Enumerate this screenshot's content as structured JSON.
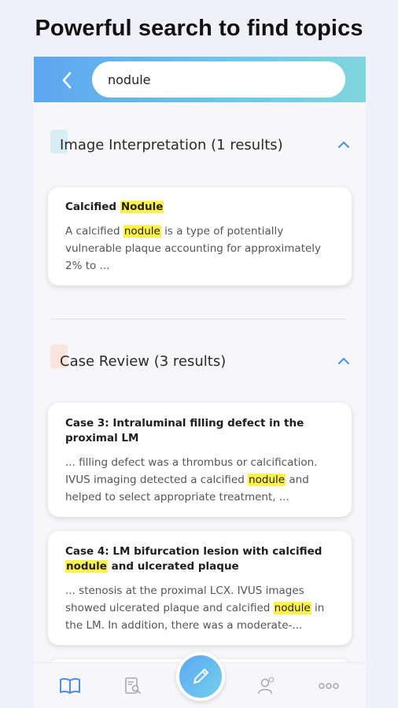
{
  "headline": "Powerful search to find topics",
  "search": {
    "query": "nodule"
  },
  "sections": [
    {
      "title": "Image Interpretation (1 results)",
      "accent_color": "#d6eef4",
      "results": [
        {
          "title_pre": "Calcified ",
          "title_hl": "Nodule",
          "body_pre": "A calcified ",
          "body_hl": "nodule",
          "body_post": " is a type of potentially vulnerable plaque accounting for approximately 2% to ..."
        }
      ]
    },
    {
      "title": "Case Review (3 results)",
      "accent_color": "#fbe4dd",
      "results": [
        {
          "title": "Case 3: Intraluminal filling defect in the proximal LM",
          "body_pre": "... filling defect was a thrombus or calcification. IVUS imaging detected a calcified ",
          "body_hl": "nodule",
          "body_post": " and helped to select appropriate treatment, ..."
        },
        {
          "title_pre": "Case 4: LM bifurcation lesion with calcified ",
          "title_hl": "nodule",
          "title_post": " and ulcerated plaque",
          "body_pre": "... stenosis at the proximal LCX. IVUS images showed ulcerated plaque and calcified ",
          "body_hl": "nodule",
          "body_post": " in the LM. In addition, there was a moderate-..."
        }
      ]
    }
  ],
  "bottom_nav": {
    "items": [
      "book-icon",
      "search-document-icon",
      "edit-icon",
      "profile-icon",
      "more-icon"
    ],
    "active_color": "#4a90e2",
    "inactive_color": "#a9a9b3"
  },
  "colors": {
    "highlight": "#fff34a",
    "topbar_start": "#5da6f0",
    "topbar_end": "#7fd6dc"
  }
}
